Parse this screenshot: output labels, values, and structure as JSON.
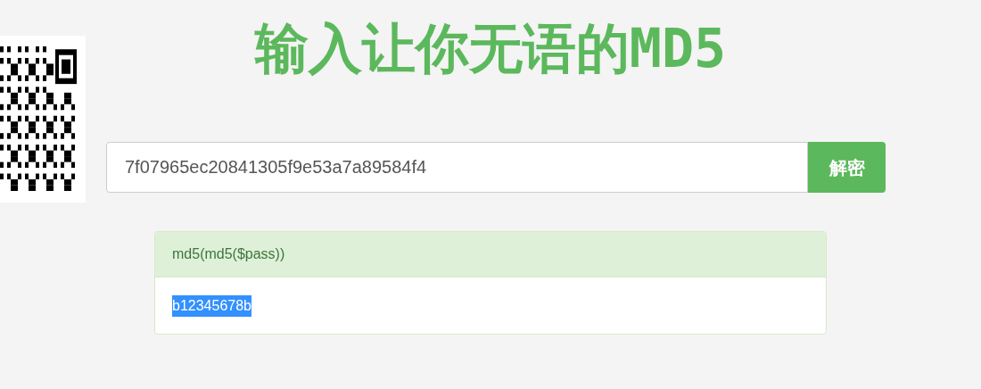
{
  "title": "输入让你无语的MD5",
  "search": {
    "value": "7f07965ec20841305f9e53a7a89584f4",
    "button": "解密"
  },
  "result": {
    "heading": "md5(md5($pass))",
    "value": "b12345678b",
    "selected": true
  }
}
